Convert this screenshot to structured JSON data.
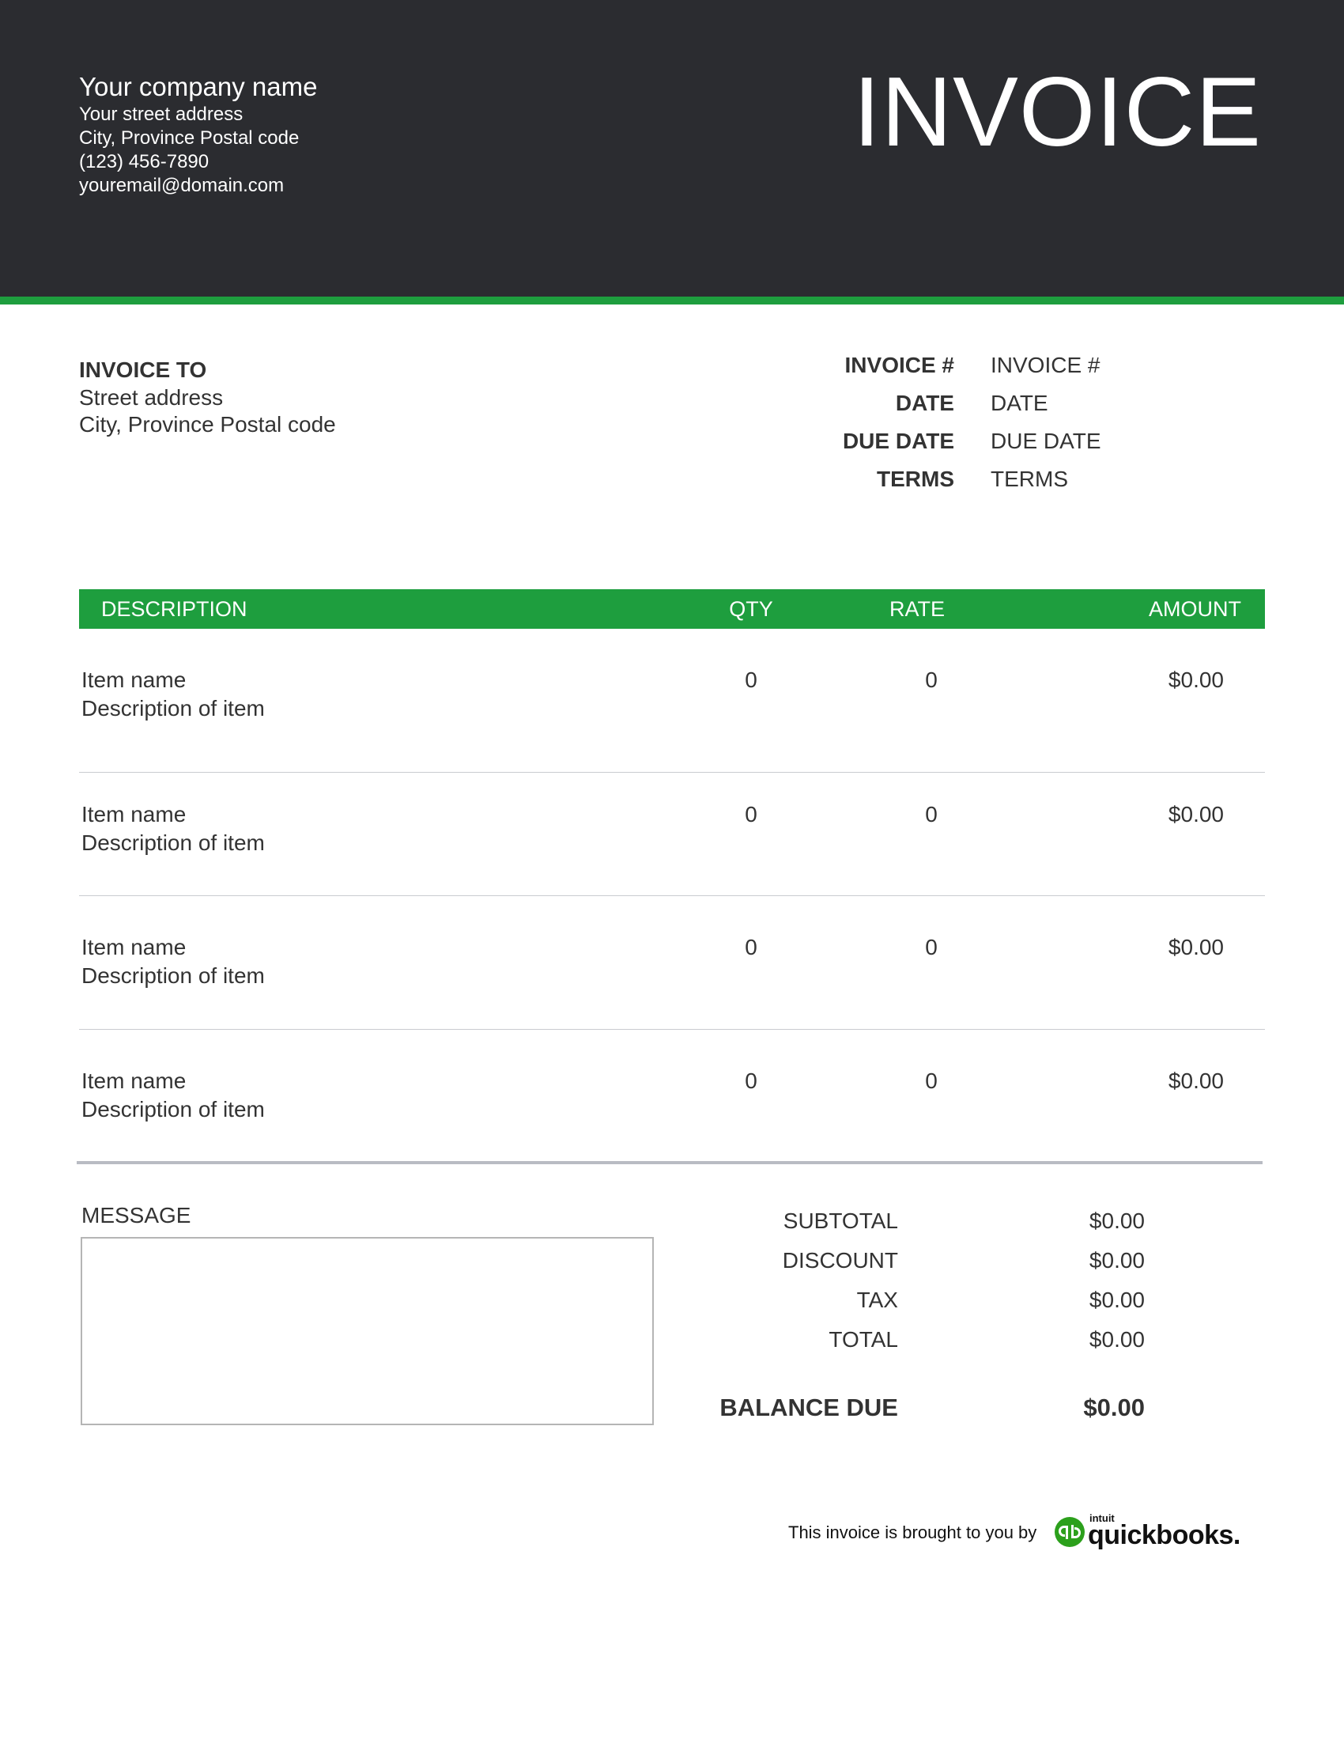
{
  "header": {
    "company_name": "Your company name",
    "street": "Your street address",
    "city": "City, Province Postal code",
    "phone": "(123) 456-7890",
    "email": "youremail@domain.com",
    "title": "INVOICE"
  },
  "bill_to": {
    "title": "INVOICE TO",
    "street": "Street address",
    "city": "City, Province Postal code"
  },
  "meta": [
    {
      "label": "INVOICE #",
      "value": "INVOICE #"
    },
    {
      "label": "DATE",
      "value": "DATE"
    },
    {
      "label": "DUE DATE",
      "value": "DUE DATE"
    },
    {
      "label": "TERMS",
      "value": "TERMS"
    }
  ],
  "items_header": {
    "description": "DESCRIPTION",
    "qty": "QTY",
    "rate": "RATE",
    "amount": "AMOUNT"
  },
  "items": [
    {
      "name": "Item name",
      "description": "Description of item",
      "qty": "0",
      "rate": "0",
      "amount": "$0.00"
    },
    {
      "name": "Item name",
      "description": "Description of item",
      "qty": "0",
      "rate": "0",
      "amount": "$0.00"
    },
    {
      "name": "Item name",
      "description": "Description of item",
      "qty": "0",
      "rate": "0",
      "amount": "$0.00"
    },
    {
      "name": "Item name",
      "description": "Description of item",
      "qty": "0",
      "rate": "0",
      "amount": "$0.00"
    }
  ],
  "message": {
    "label": "MESSAGE",
    "value": ""
  },
  "totals": {
    "subtotal_label": "SUBTOTAL",
    "subtotal": "$0.00",
    "discount_label": "DISCOUNT",
    "discount": "$0.00",
    "tax_label": "TAX",
    "tax": "$0.00",
    "total_label": "TOTAL",
    "total": "$0.00",
    "balance_label": "BALANCE DUE",
    "balance": "$0.00"
  },
  "footer": {
    "text": "This invoice is brought to you by",
    "logo_small": "intuit",
    "logo_word": "quickbooks."
  },
  "colors": {
    "header_bg": "#2b2c30",
    "accent_green": "#1e9e3e"
  },
  "icons": {
    "logo": "quickbooks-logo-icon"
  }
}
